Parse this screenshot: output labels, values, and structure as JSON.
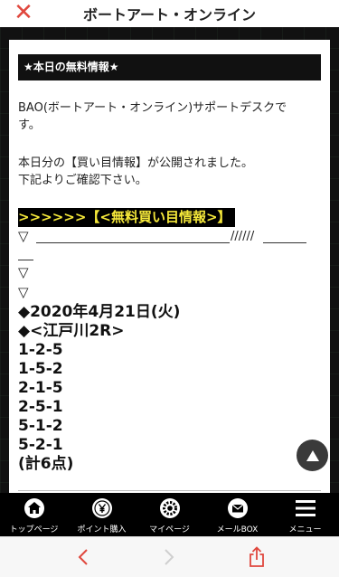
{
  "header": {
    "title": "ボートアート・オンライン",
    "close_icon": "close-icon"
  },
  "card": {
    "info_title": "★本日の無料情報★",
    "para1_line1": "BAO(ボートアート・オンライン)サポートデスクで",
    "para1_line2": "す。",
    "para2_line1": "本日分の【買い目情報】が公開されました。",
    "para2_line2": "下記よりご確認下さい。",
    "highlight": ">>>>>>【<無料買い目情報>】",
    "triangle": "▽",
    "slashes": "//////",
    "date": "◆2020年4月21日(火)",
    "race": "◆<江戸川2R>",
    "picks": [
      "1-2-5",
      "1-5-2",
      "2-1-5",
      "2-5-1",
      "5-1-2",
      "5-2-1"
    ],
    "total": "(計6点)"
  },
  "bottom_nav": {
    "items": [
      {
        "label": "トップページ",
        "icon": "home-icon"
      },
      {
        "label": "ポイント購入",
        "icon": "yen-coin-icon"
      },
      {
        "label": "マイページ",
        "icon": "gear-icon"
      },
      {
        "label": "メールBOX",
        "icon": "mail-icon"
      },
      {
        "label": "メニュー",
        "icon": "hamburger-menu-icon"
      }
    ]
  },
  "browser": {
    "back_icon": "back-arrow-icon",
    "forward_icon": "forward-arrow-icon",
    "share_icon": "share-icon"
  },
  "colors": {
    "accent_red": "#e0473d",
    "highlight_text": "#f5e83a",
    "nav_bg": "#000000"
  }
}
